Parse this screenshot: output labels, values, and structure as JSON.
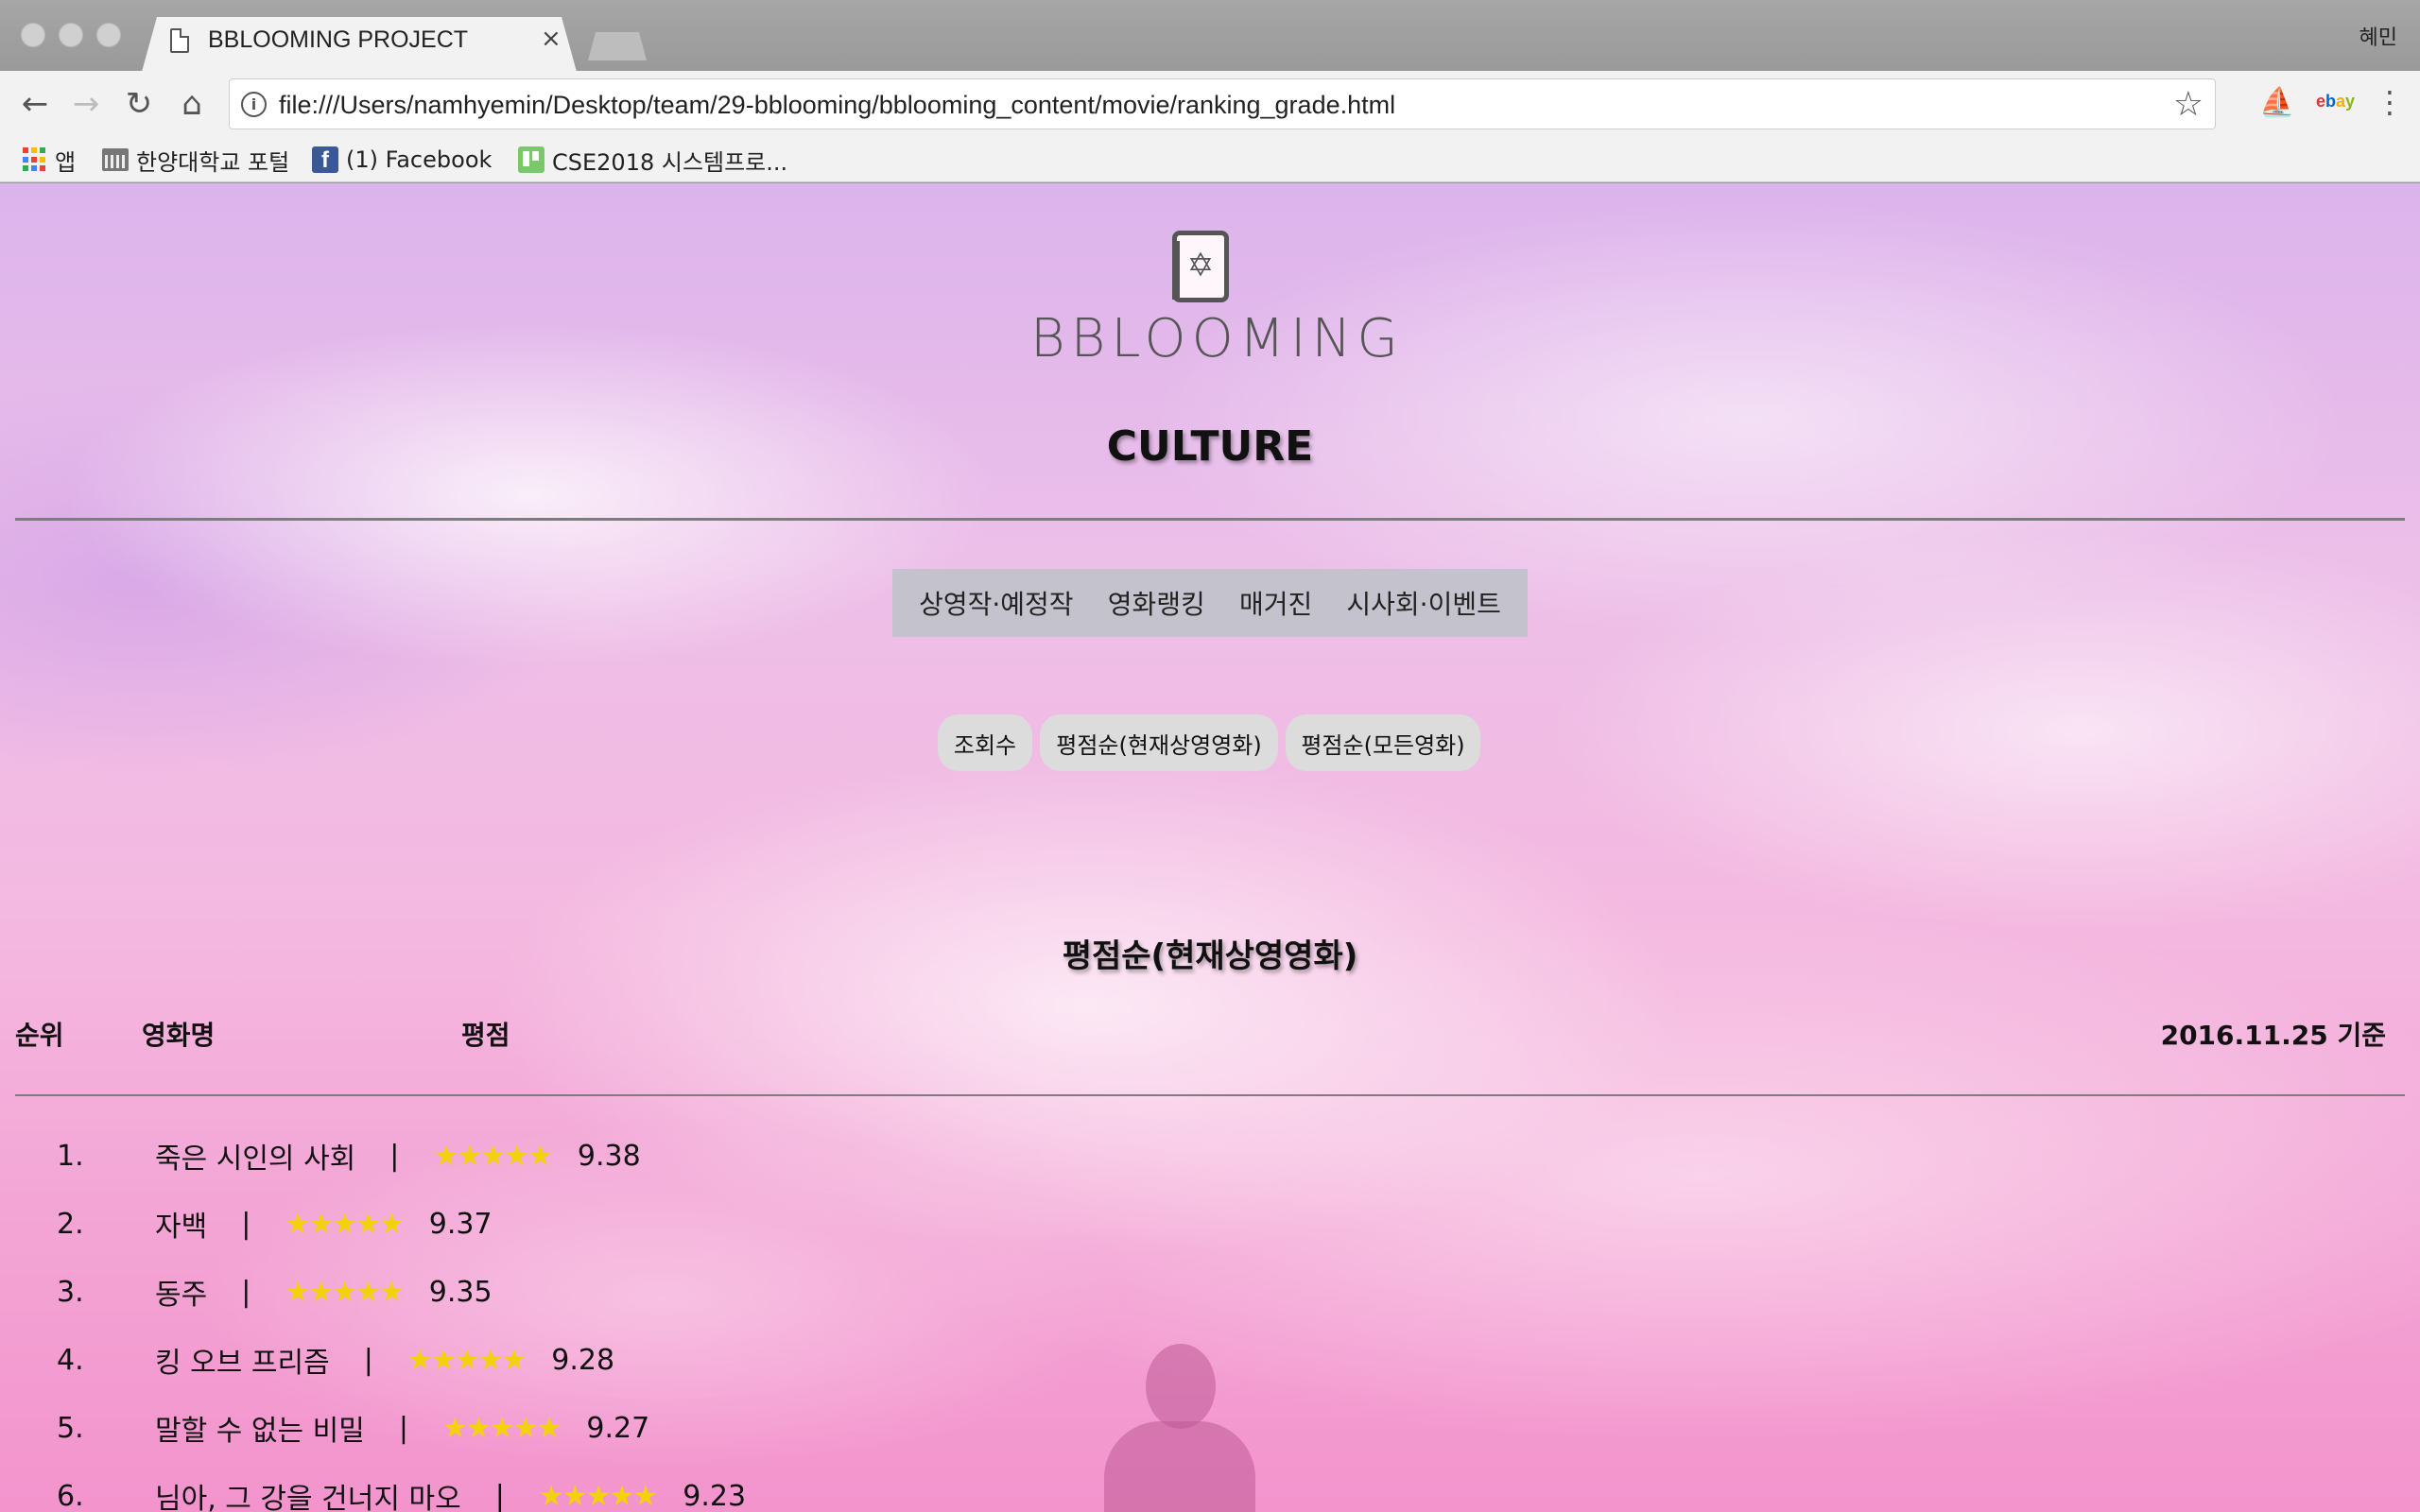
{
  "browser": {
    "tab_title": "BBLOOMING PROJECT",
    "tab_close": "×",
    "profile": "혜민",
    "url": "file:///Users/namhyemin/Desktop/team/29-bblooming/bblooming_content/movie/ranking_grade.html",
    "nav": {
      "back": "←",
      "forward": "→",
      "reload": "↻",
      "home": "⌂",
      "info": "i",
      "star": "☆",
      "menu": "⋮",
      "ext_sail": "⛵"
    },
    "bookmarks": [
      {
        "label": "앱",
        "icon": "apps-grid-icon"
      },
      {
        "label": "한양대학교 포털",
        "icon": "university-icon"
      },
      {
        "label": "(1) Facebook",
        "icon": "facebook-icon"
      },
      {
        "label": "CSE2018 시스템프로...",
        "icon": "trello-icon"
      }
    ],
    "apps_colors": [
      "#ea4335",
      "#fbbc05",
      "#34a853",
      "#4285f4",
      "#ea4335",
      "#fbbc05",
      "#34a853",
      "#4285f4",
      "#ea4335"
    ]
  },
  "page": {
    "logo_text": "BBLOOMING",
    "section_title": "CULTURE",
    "main_nav": [
      "상영작·예정작",
      "영화랭킹",
      "매거진",
      "시사회·이벤트"
    ],
    "sub_nav": [
      "조회수",
      "평점순(현재상영영화)",
      "평점순(모든영화)"
    ],
    "list_title": "평점순(현재상영영화)",
    "columns": {
      "rank": "순위",
      "title": "영화명",
      "grade": "평점",
      "date": "2016.11.25 기준"
    },
    "rankings": [
      {
        "rank": "1.",
        "title": "죽은 시인의 사회",
        "sep": "|",
        "stars": "★★★★★",
        "score": "9.38"
      },
      {
        "rank": "2.",
        "title": "자백",
        "sep": "|",
        "stars": "★★★★★",
        "score": "9.37"
      },
      {
        "rank": "3.",
        "title": "동주",
        "sep": "|",
        "stars": "★★★★★",
        "score": "9.35"
      },
      {
        "rank": "4.",
        "title": "킹 오브 프리즘",
        "sep": "|",
        "stars": "★★★★★",
        "score": "9.28"
      },
      {
        "rank": "5.",
        "title": "말할 수 없는 비밀",
        "sep": "|",
        "stars": "★★★★★",
        "score": "9.27"
      },
      {
        "rank": "6.",
        "title": "님아, 그 강을 건너지 마오",
        "sep": "|",
        "stars": "★★★★★",
        "score": "9.23"
      }
    ],
    "star_color": "#f4d20a"
  }
}
